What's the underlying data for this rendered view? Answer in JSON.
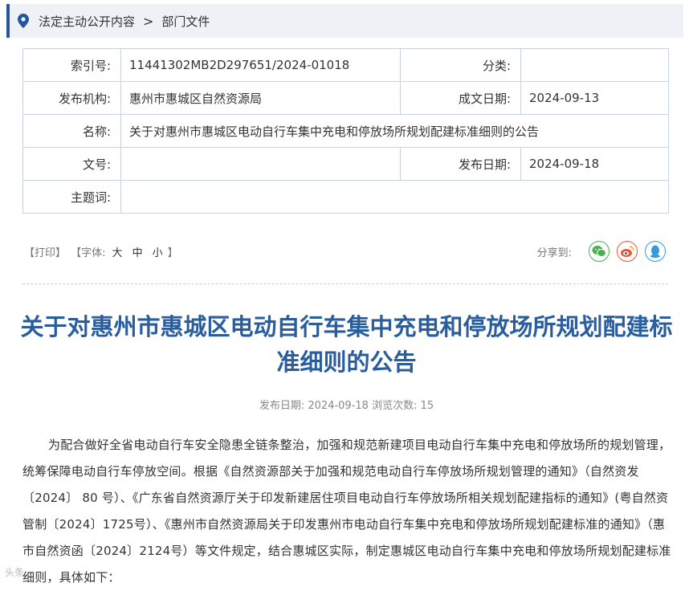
{
  "breadcrumb": {
    "item1": "法定主动公开内容",
    "separator": ">",
    "item2": "部门文件"
  },
  "meta": {
    "index_label": "索引号:",
    "index_value": "11441302MB2D297651/2024-01018",
    "category_label": "分类:",
    "category_value": "",
    "publisher_label": "发布机构:",
    "publisher_value": "惠州市惠城区自然资源局",
    "created_label": "成文日期:",
    "created_value": "2024-09-13",
    "name_label": "名称:",
    "name_value": "关于对惠州市惠城区电动自行车集中充电和停放场所规划配建标准细则的公告",
    "docno_label": "文号:",
    "docno_value": "",
    "pubdate_label": "发布日期:",
    "pubdate_value": "2024-09-18",
    "subject_label": "主题词:",
    "subject_value": ""
  },
  "tools": {
    "print": "【打印】",
    "font_prefix": "【字体:",
    "font_large": "大",
    "font_medium": "中",
    "font_small": "小",
    "font_suffix": "】",
    "share_label": "分享到:"
  },
  "article": {
    "title": "关于对惠州市惠城区电动自行车集中充电和停放场所规划配建标准细则的公告",
    "pubinfo": "发布日期: 2024-09-18 浏览次数: 15",
    "body": "为配合做好全省电动自行车安全隐患全链条整治，加强和规范新建项目电动自行车集中充电和停放场所的规划管理，统筹保障电动自行车停放空间。根据《自然资源部关于加强和规范电动自行车停放场所规划管理的通知》（自然资发〔2024〕 80 号）、《广东省自然资源厅关于印发新建居住项目电动自行车停放场所相关规划配建指标的通知》(粤自然资管制〔2024〕1725号）、《惠州市自然资源局关于印发惠州市电动自行车集中充电和停放场所规划配建标准的通知》（惠市自然资函〔2024〕2124号）等文件规定，结合惠城区实际，制定惠城区电动自行车集中充电和停放场所规划配建标准细则，具体如下："
  },
  "watermark": "头条"
}
